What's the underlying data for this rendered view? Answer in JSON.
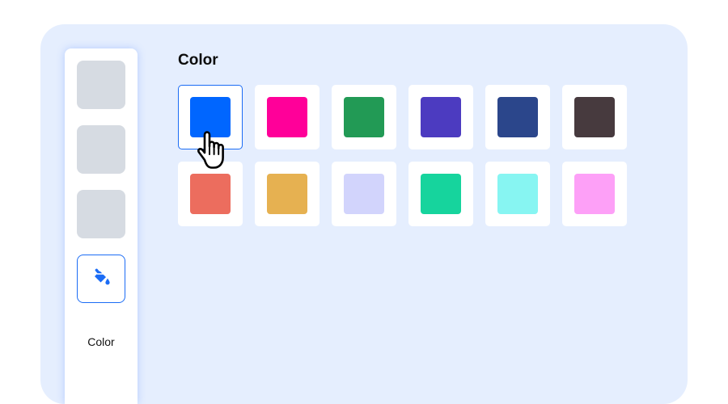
{
  "sidebar": {
    "items": [
      {
        "name": "sidebar-item-1",
        "active": false
      },
      {
        "name": "sidebar-item-2",
        "active": false
      },
      {
        "name": "sidebar-item-3",
        "active": false
      },
      {
        "name": "sidebar-item-color",
        "active": true,
        "icon": "paint-bucket-icon",
        "label": "Color"
      }
    ]
  },
  "main": {
    "title": "Color",
    "selected_index": 0,
    "swatches": [
      "#0066ff",
      "#ff0099",
      "#229a55",
      "#4c3bc0",
      "#2b468b",
      "#473a3e",
      "#ec6d5e",
      "#e6b151",
      "#d2d4fc",
      "#16d49d",
      "#87f5f2",
      "#fda0f7"
    ]
  },
  "colors": {
    "accent": "#1b6cf5",
    "panel_background": "#e5eefe",
    "placeholder": "#d6dbe2"
  }
}
